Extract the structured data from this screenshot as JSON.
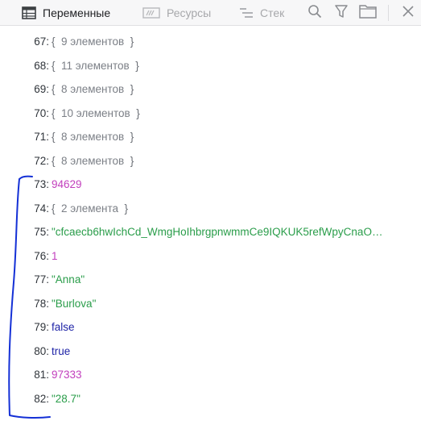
{
  "toolbar": {
    "tabs": [
      {
        "label": "Переменные",
        "icon": "table-icon",
        "active": true
      },
      {
        "label": "Ресурсы",
        "icon": "storage-icon",
        "active": false
      },
      {
        "label": "Стек",
        "icon": "stack-icon",
        "active": false
      }
    ],
    "tools": [
      "search-icon",
      "filter-icon",
      "folder-icon",
      "close-icon"
    ]
  },
  "rows": [
    {
      "index": "67:",
      "type": "object",
      "open": "{",
      "text": "9 элементов",
      "close": "}"
    },
    {
      "index": "68:",
      "type": "object",
      "open": "{",
      "text": "11 элементов",
      "close": "}"
    },
    {
      "index": "69:",
      "type": "object",
      "open": "{",
      "text": "8 элементов",
      "close": "}"
    },
    {
      "index": "70:",
      "type": "object",
      "open": "{",
      "text": "10 элементов",
      "close": "}"
    },
    {
      "index": "71:",
      "type": "object",
      "open": "{",
      "text": "8 элементов",
      "close": "}"
    },
    {
      "index": "72:",
      "type": "object",
      "open": "{",
      "text": "8 элементов",
      "close": "}"
    },
    {
      "index": "73:",
      "type": "number",
      "text": "94629"
    },
    {
      "index": "74:",
      "type": "object",
      "open": "{",
      "text": "2 элемента",
      "close": "}"
    },
    {
      "index": "75:",
      "type": "string",
      "text": "\"cfcaecb6hwIchCd_WmgHoIhbrgpnwmmCe9IQKUK5refWpyCnaO…"
    },
    {
      "index": "76:",
      "type": "number",
      "text": "1"
    },
    {
      "index": "77:",
      "type": "string",
      "text": "\"Anna\""
    },
    {
      "index": "78:",
      "type": "string",
      "text": "\"Burlova\""
    },
    {
      "index": "79:",
      "type": "bool",
      "text": "false"
    },
    {
      "index": "80:",
      "type": "bool",
      "text": "true"
    },
    {
      "index": "81:",
      "type": "number",
      "text": "97333"
    },
    {
      "index": "82:",
      "type": "string",
      "text": "\"28.7\""
    }
  ],
  "colors": {
    "number": "#c23fbd",
    "string": "#2a9d4a",
    "bool": "#1f24a7",
    "annotation": "#1430d6"
  }
}
